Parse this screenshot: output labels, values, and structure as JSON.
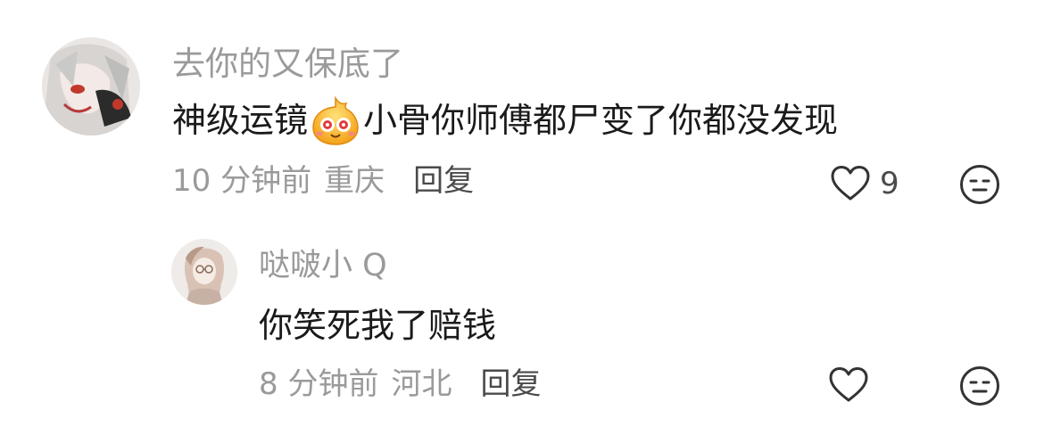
{
  "comments": [
    {
      "username": "去你的又保底了",
      "text_before_emoji": "神级运镜",
      "emoji": "excited-face-emoji",
      "text_after_emoji": "小骨你师傅都尸变了你都没发现",
      "time": "10 分钟前",
      "location": "重庆",
      "reply_label": "回复",
      "like_count": "9",
      "like_icon": "heart-outline-icon",
      "dislike_icon": "expressionless-face-icon"
    },
    {
      "username": "哒啵小 Q",
      "text": "你笑死我了赔钱",
      "time": "8 分钟前",
      "location": "河北",
      "reply_label": "回复",
      "like_icon": "heart-outline-icon",
      "dislike_icon": "expressionless-face-icon"
    }
  ],
  "colors": {
    "secondary_text": "#9a9a9a",
    "primary_text": "#1a1a1a",
    "icon_stroke": "#333333"
  }
}
